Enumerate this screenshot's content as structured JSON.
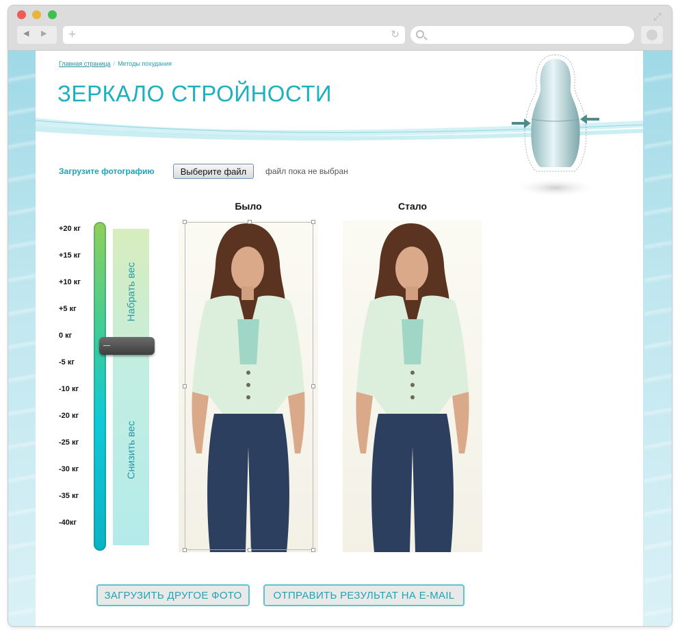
{
  "browser": {
    "url": "",
    "search_placeholder": ""
  },
  "breadcrumb": {
    "home": "Главная страница",
    "separator": "/",
    "current": "Методы похудания"
  },
  "page": {
    "title": "ЗЕРКАЛО СТРОЙНОСТИ"
  },
  "upload": {
    "label": "Загрузите фотографию",
    "button": "Выберите файл",
    "status": "файл пока не выбран"
  },
  "columns": {
    "before": "Было",
    "after": "Стало"
  },
  "scale": {
    "labels": [
      "+20 кг",
      "+15 кг",
      "+10 кг",
      "+5 кг",
      "0 кг",
      "-5 кг",
      "-10 кг",
      "-20 кг",
      "-25 кг",
      "-30 кг",
      "-35 кг",
      "-40кг"
    ],
    "current_label": "0 кг",
    "gain_text": "Набрать вес",
    "lose_text": "Снизить вес"
  },
  "actions": {
    "reload_photo": "ЗАГРУЗИТЬ ДРУГОЕ ФОТО",
    "send_email": "ОТПРАВИТЬ РЕЗУЛЬТАТ НА E-MAIL"
  },
  "colors": {
    "accent": "#1fb0bf",
    "slider_top": "#8fd05a",
    "slider_bottom": "#0bb3c4",
    "thumb": "#4a4a4a"
  }
}
